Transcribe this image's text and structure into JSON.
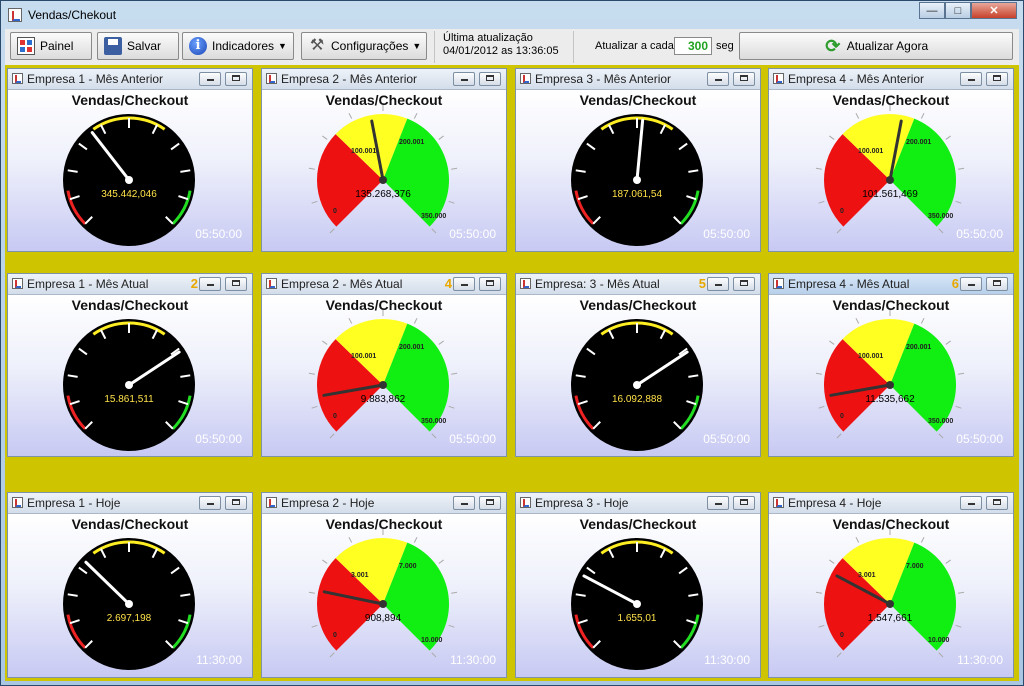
{
  "window": {
    "title": "Vendas/Chekout"
  },
  "toolbar": {
    "painel": "Painel",
    "salvar": "Salvar",
    "indicadores": "Indicadores",
    "configuracoes": "Configurações",
    "last_update_label": "Última atualização",
    "last_update_value": "04/01/2012 as 13:36:05",
    "interval_label": "Atualizar a cada",
    "interval_value": "300",
    "interval_unit": "seg",
    "update_now": "Atualizar Agora"
  },
  "panels": [
    {
      "title": "Empresa 1 - Mês Anterior",
      "number": "",
      "chart_title": "Vendas/Checkout",
      "style": "dark",
      "value_label": "345.442,046",
      "time": "05:50:00",
      "needle": 0.36,
      "labels": []
    },
    {
      "title": "Empresa 2 - Mês Anterior",
      "number": "",
      "chart_title": "Vendas/Checkout",
      "style": "color",
      "value_label": "135.268,376",
      "time": "05:50:00",
      "needle": 0.46,
      "labels": [
        "0",
        "100.001",
        "200.001",
        "350.000"
      ]
    },
    {
      "title": "Empresa 3 - Mês Anterior",
      "number": "",
      "chart_title": "Vendas/Checkout",
      "style": "dark",
      "value_label": "187.061,54",
      "time": "05:50:00",
      "needle": 0.52,
      "labels": []
    },
    {
      "title": "Empresa 4 - Mês Anterior",
      "number": "",
      "chart_title": "Vendas/Checkout",
      "style": "color",
      "value_label": "101.561,469",
      "time": "05:50:00",
      "needle": 0.54,
      "labels": [
        "0",
        "100.001",
        "200.001",
        "350.000"
      ]
    },
    {
      "title": "Empresa 1 - Mês Atual",
      "number": "2",
      "chart_title": "Vendas/Checkout",
      "style": "dark",
      "value_label": "15.861,511",
      "time": "05:50:00",
      "needle": 0.71,
      "labels": []
    },
    {
      "title": "Empresa 2 - Mês Atual",
      "number": "4",
      "chart_title": "Vendas/Checkout",
      "style": "color",
      "value_label": "9.883,862",
      "time": "05:50:00",
      "needle": 0.13,
      "labels": [
        "0",
        "100.001",
        "200.001",
        "350.000"
      ]
    },
    {
      "title": "Empresa: 3 - Mês Atual",
      "number": "5",
      "chart_title": "Vendas/Checkout",
      "style": "dark",
      "value_label": "16.092,888",
      "time": "05:50:00",
      "needle": 0.71,
      "labels": []
    },
    {
      "title": "Empresa 4 - Mês Atual",
      "number": "6",
      "chart_title": "Vendas/Checkout",
      "style": "color",
      "value_label": "11.535,662",
      "time": "05:50:00",
      "needle": 0.13,
      "active": true,
      "labels": [
        "0",
        "100.001",
        "200.001",
        "350.000"
      ]
    },
    {
      "title": "Empresa 1 - Hoje",
      "number": "",
      "chart_title": "Vendas/Checkout",
      "style": "dark",
      "value_label": "2.697,198",
      "time": "11:30:00",
      "needle": 0.33,
      "labels": []
    },
    {
      "title": "Empresa 2 - Hoje",
      "number": "",
      "chart_title": "Vendas/Checkout",
      "style": "color",
      "value_label": "908,894",
      "time": "11:30:00",
      "needle": 0.21,
      "labels": [
        "0",
        "3.001",
        "7.000",
        "10.000"
      ]
    },
    {
      "title": "Empresa 3 - Hoje",
      "number": "",
      "chart_title": "Vendas/Checkout",
      "style": "dark",
      "value_label": "1.655,01",
      "time": "11:30:00",
      "needle": 0.27,
      "labels": []
    },
    {
      "title": "Empresa 4 - Hoje",
      "number": "",
      "chart_title": "Vendas/Checkout",
      "style": "color",
      "value_label": "1.547,661",
      "time": "11:30:00",
      "needle": 0.27,
      "labels": [
        "0",
        "3.001",
        "7.000",
        "10.000"
      ]
    }
  ],
  "colors": {
    "background_band": "#cfc400",
    "gauge_red": "#ee1111",
    "gauge_yellow": "#ffff22",
    "gauge_green": "#11ee11",
    "gauge_dark": "#000000",
    "value_text": "#ffe24a"
  }
}
